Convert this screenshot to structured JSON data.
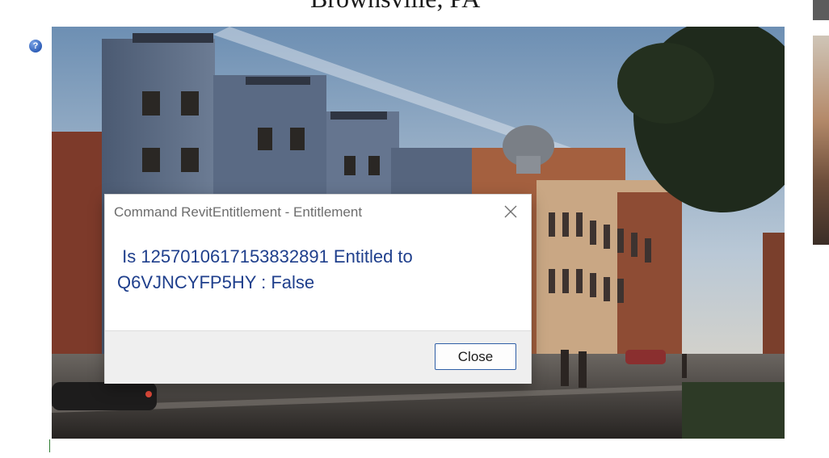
{
  "page": {
    "title": "Brownsville, PA"
  },
  "help": {
    "glyph": "?"
  },
  "hero": {
    "alt": "Brownsville building rendering"
  },
  "dialog": {
    "title": "Command RevitEntitlement - Entitlement",
    "message": " Is 1257010617153832891 Entitled to\nQ6VJNCYFP5HY : False",
    "close_button_label": "Close"
  }
}
